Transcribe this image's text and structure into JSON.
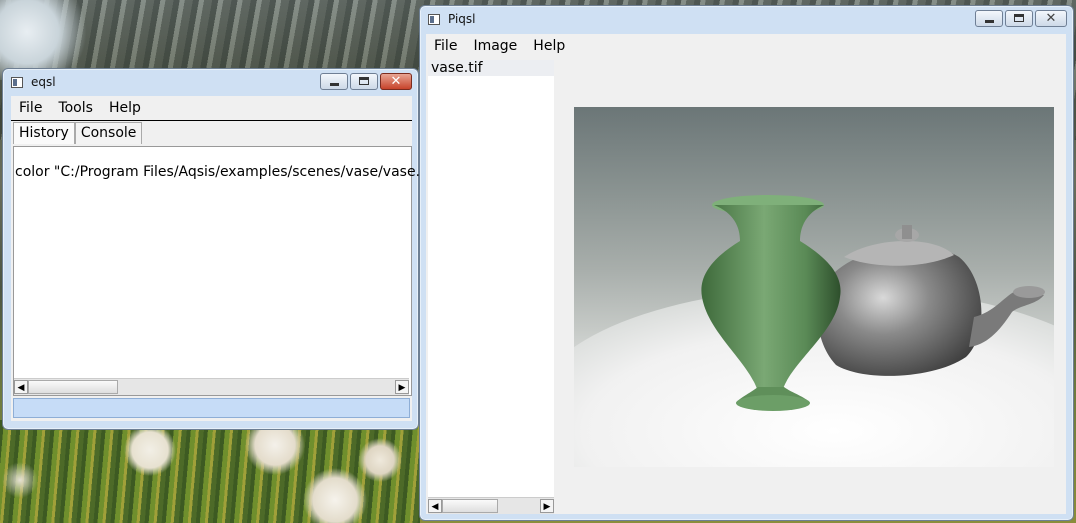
{
  "eqsl": {
    "title": "eqsl",
    "menu": [
      "File",
      "Tools",
      "Help"
    ],
    "tabs": [
      "History",
      "Console"
    ],
    "history": [
      "color  \"C:/Program Files/Aqsis/examples/scenes/vase/vase.rib\""
    ],
    "command_value": ""
  },
  "piqsl": {
    "title": "Piqsl",
    "menu": [
      "File",
      "Image",
      "Help"
    ],
    "files": [
      "vase.tif"
    ]
  }
}
